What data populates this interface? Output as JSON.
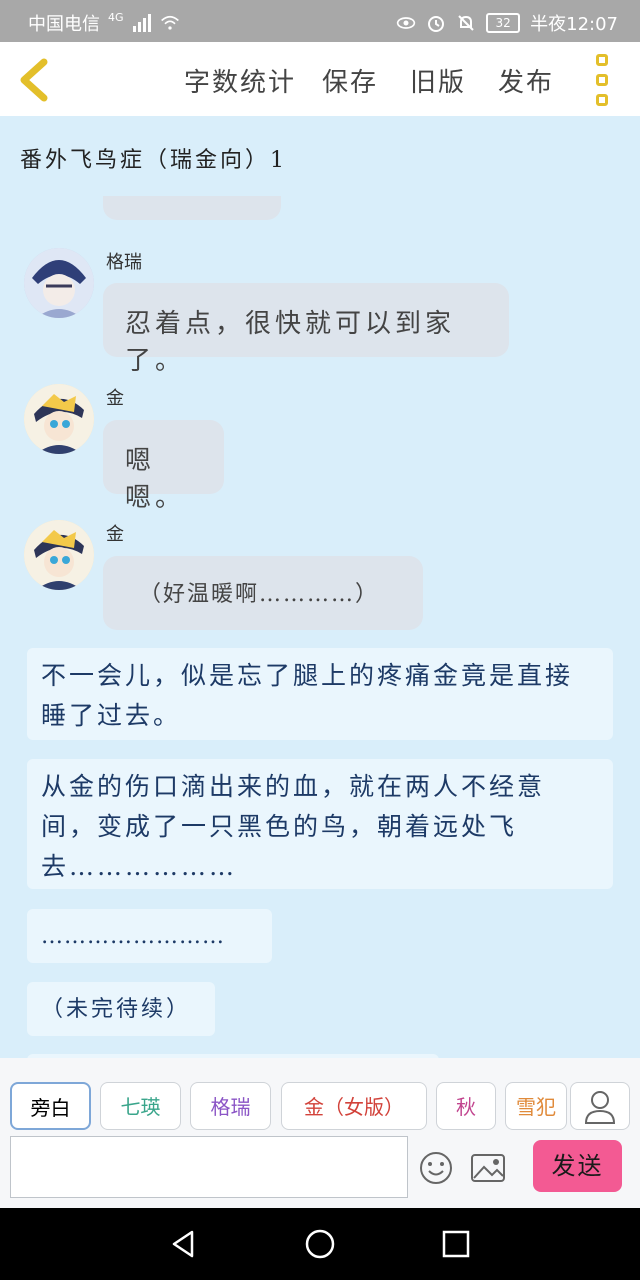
{
  "status_bar": {
    "carrier": "中国电信",
    "network": "4G",
    "battery": "32",
    "time": "半夜12:07"
  },
  "topbar": {
    "word_count": "字数统计",
    "save": "保存",
    "old_version": "旧版",
    "publish": "发布"
  },
  "story_title": "番外飞鸟症（瑞金向）1",
  "messages": [
    {
      "speaker": "格瑞",
      "text": "忍着点，很快就可以到家了。"
    },
    {
      "speaker": "金",
      "text": "嗯嗯。"
    },
    {
      "speaker": "金",
      "text": "（好温暖啊…………）"
    }
  ],
  "narrations": [
    "不一会儿，似是忘了腿上的疼痛金竟是直接睡了过去。",
    "从金的伤口滴出来的血，就在两人不经意间，变成了一只黑色的鸟，朝着远处飞去………………",
    "……………………",
    "（未完待续）"
  ],
  "roles": [
    "旁白",
    "七瑛",
    "格瑞",
    "金（女版）",
    "秋",
    "雪犯"
  ],
  "role_colors": [
    "#555555",
    "#3aa58b",
    "#8b55c6",
    "#d2423a",
    "#c2458f",
    "#e08a3a"
  ],
  "send_label": "发送",
  "icons": {
    "back": "chevron-left-icon",
    "more": "more-vertical-icon",
    "person": "person-icon",
    "emoji": "emoji-icon",
    "image": "image-icon"
  }
}
